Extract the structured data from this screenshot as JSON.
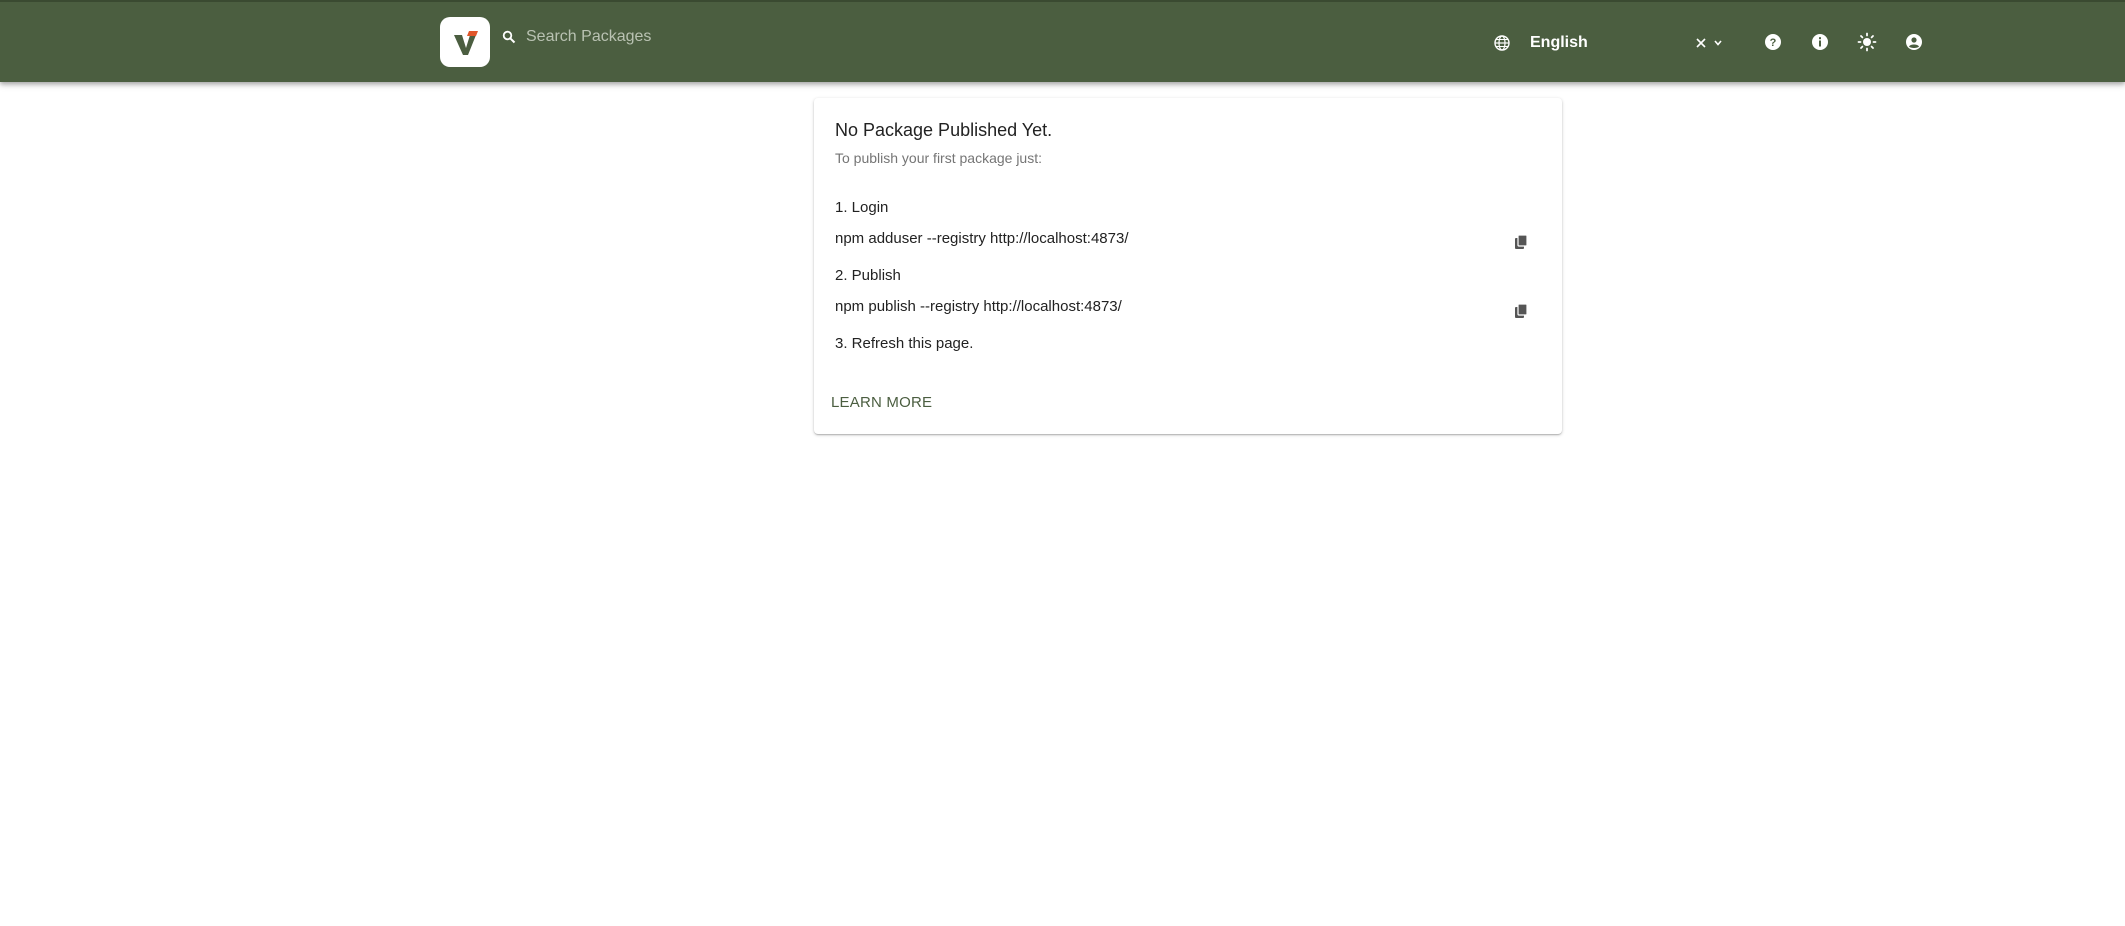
{
  "header": {
    "logo_icon": "verdaccio-logo-icon",
    "search": {
      "icon": "search-icon",
      "placeholder": "Search Packages",
      "value": ""
    },
    "language": {
      "icon": "globe-icon",
      "value": "English",
      "clear_icon": "close-icon",
      "open_icon": "chevron-down-icon"
    },
    "buttons": [
      {
        "name": "help-icon"
      },
      {
        "name": "info-icon"
      },
      {
        "name": "theme-toggle-icon"
      },
      {
        "name": "account-icon"
      }
    ],
    "colors": {
      "bar": "#4b5e40",
      "logo_accent": "#e0562a"
    }
  },
  "empty_state": {
    "title": "No Package Published Yet.",
    "subtitle": "To publish your first package just:",
    "steps": [
      {
        "label": "1. Login",
        "command": "npm adduser --registry http://localhost:4873/",
        "copy_icon": "copy-icon"
      },
      {
        "label": "2. Publish",
        "command": "npm publish --registry http://localhost:4873/",
        "copy_icon": "copy-icon"
      },
      {
        "label": "3. Refresh this page."
      }
    ],
    "learn_more": "LEARN MORE"
  }
}
